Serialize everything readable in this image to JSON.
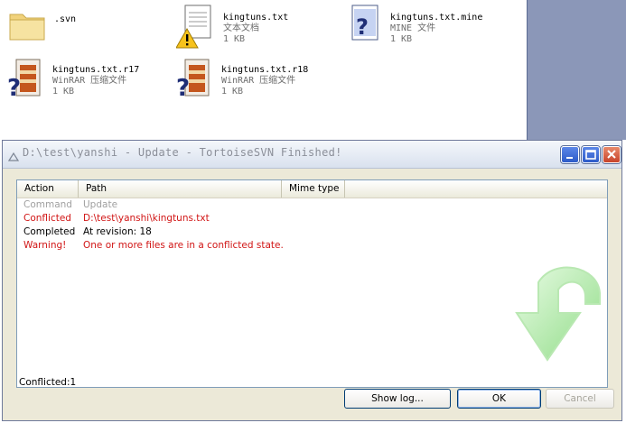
{
  "explorer": {
    "files": [
      {
        "name": ".svn",
        "type": "",
        "size": "",
        "icon": "folder-icon"
      },
      {
        "name": "kingtuns.txt",
        "type": "文本文档",
        "size": "1 KB",
        "icon": "conflict-text-file-icon"
      },
      {
        "name": "kingtuns.txt.mine",
        "type": "MINE 文件",
        "size": "1 KB",
        "icon": "unknown-file-icon"
      },
      {
        "name": "kingtuns.txt.r17",
        "type": "WinRAR 压缩文件",
        "size": "1 KB",
        "icon": "winrar-file-icon"
      },
      {
        "name": "kingtuns.txt.r18",
        "type": "WinRAR 压缩文件",
        "size": "1 KB",
        "icon": "winrar-file-icon"
      }
    ]
  },
  "dialog": {
    "title": "D:\\test\\yanshi - Update - TortoiseSVN Finished!",
    "columns": {
      "action": "Action",
      "path": "Path",
      "mime": "Mime type"
    },
    "rows": [
      {
        "action": "Command",
        "path": "Update",
        "color": "#a0a0a0"
      },
      {
        "action": "Conflicted",
        "path": "D:\\test\\yanshi\\kingtuns.txt",
        "color": "#d11515"
      },
      {
        "action": "Completed",
        "path": "At revision: 18",
        "color": "#000000"
      },
      {
        "action": "Warning!",
        "path": "One or more files are in a conflicted state.",
        "color": "#d11515"
      }
    ],
    "status": "Conflicted:1",
    "buttons": {
      "show_log": "Show log...",
      "ok": "OK",
      "cancel": "Cancel"
    }
  },
  "colors": {
    "accent": "#2d5bc8",
    "conflict_red": "#d11515",
    "arrow_green": "#9ee89a"
  }
}
